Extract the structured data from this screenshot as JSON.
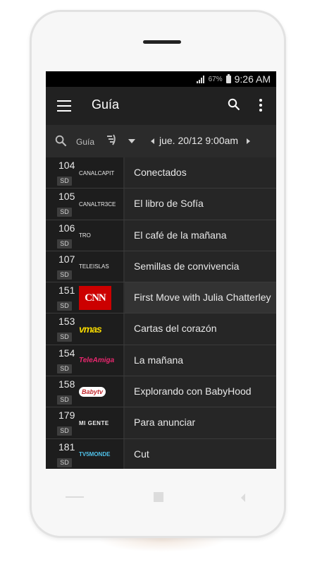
{
  "status_bar": {
    "battery_percent": "67%",
    "time": "9:26 AM"
  },
  "app_bar": {
    "title": "Guía"
  },
  "filter_bar": {
    "search_label": "Guía",
    "date_time": "jue. 20/12 9:00am"
  },
  "channels": [
    {
      "number": "104",
      "quality": "SD",
      "logo_text": "CANALCAPIT",
      "logo_icon": "text-logo",
      "program": "Conectados"
    },
    {
      "number": "105",
      "quality": "SD",
      "logo_text": "CANALTR3CE",
      "logo_icon": "text-logo",
      "program": "El libro de Sofía"
    },
    {
      "number": "106",
      "quality": "SD",
      "logo_text": "TRO",
      "logo_icon": "text-logo",
      "program": "El café de la mañana"
    },
    {
      "number": "107",
      "quality": "SD",
      "logo_text": "TELEISLAS",
      "logo_icon": "text-logo",
      "program": "Semillas de convivencia"
    },
    {
      "number": "151",
      "quality": "SD",
      "logo_text": "CNN",
      "logo_icon": "cnn-logo",
      "program": "First Move with Julia Chatterley"
    },
    {
      "number": "153",
      "quality": "SD",
      "logo_text": "vmas",
      "logo_icon": "vmas-logo",
      "program": "Cartas del corazón"
    },
    {
      "number": "154",
      "quality": "SD",
      "logo_text": "TeleAmiga",
      "logo_icon": "teleamiga-logo",
      "program": "La mañana"
    },
    {
      "number": "158",
      "quality": "SD",
      "logo_text": "Babytv",
      "logo_icon": "babytv-logo",
      "program": "Explorando con BabyHood"
    },
    {
      "number": "179",
      "quality": "SD",
      "logo_text": "MI GENTE",
      "logo_icon": "migente-logo",
      "program": "Para anunciar"
    },
    {
      "number": "181",
      "quality": "SD",
      "logo_text": "TV5MONDE",
      "logo_icon": "tv5monde-logo",
      "program": "Cut"
    }
  ],
  "active_row": 4,
  "colors": {
    "background": "#2f2f2f",
    "appbar": "#212121",
    "accent_cnn": "#cc0000"
  }
}
